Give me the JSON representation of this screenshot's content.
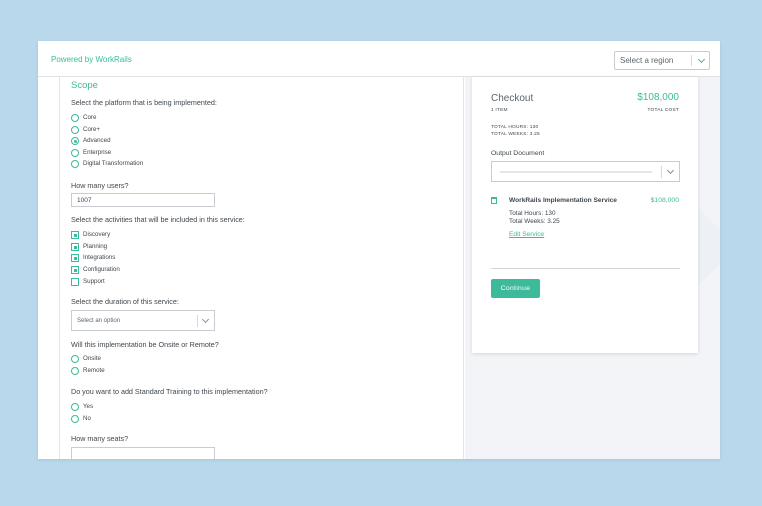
{
  "header": {
    "brand": "Powered by WorkRails",
    "region_select": {
      "value": "Select a region"
    }
  },
  "form": {
    "section_title": "Scope",
    "q_platform": "Select the platform that is being implemented:",
    "platforms": [
      {
        "label": "Core",
        "selected": false
      },
      {
        "label": "Core+",
        "selected": false
      },
      {
        "label": "Advanced",
        "selected": true
      },
      {
        "label": "Enterprise",
        "selected": false
      },
      {
        "label": "Digital Transformation",
        "selected": false
      }
    ],
    "q_users": "How many users?",
    "users_value": "1007",
    "q_activities": "Select the activities that will be included in this service:",
    "activities": [
      {
        "label": "Discovery",
        "checked": true
      },
      {
        "label": "Planning",
        "checked": true
      },
      {
        "label": "Integrations",
        "checked": true
      },
      {
        "label": "Configuration",
        "checked": true
      },
      {
        "label": "Support",
        "checked": false
      }
    ],
    "q_duration": "Select the duration of this service:",
    "duration_select": {
      "value": "Select an option"
    },
    "q_onsite": "Will this implementation be Onsite or Remote?",
    "onsite_options": [
      {
        "label": "Onsite",
        "selected": false
      },
      {
        "label": "Remote",
        "selected": false
      }
    ],
    "q_training": "Do you want to add Standard Training to this implementation?",
    "training_options": [
      {
        "label": "Yes",
        "selected": false
      },
      {
        "label": "No",
        "selected": false
      }
    ],
    "q_seats": "How many seats?",
    "seats_value": ""
  },
  "checkout": {
    "title": "Checkout",
    "total": "$108,000",
    "item_count": "1 ITEM",
    "total_cost_label": "TOTAL COST",
    "total_hours": "TOTAL HOURS: 130",
    "total_weeks": "TOTAL WEEKS: 3.25",
    "output_document_label": "Output Document",
    "service": {
      "name": "WorkRails Implementation Service",
      "price": "$108,000",
      "hours": "Total Hours: 130",
      "weeks": "Total Weeks: 3.25",
      "edit_label": "Edit Service"
    },
    "continue_label": "Continue"
  },
  "colors": {
    "accent": "#3dba9a",
    "background": "#b9d8ec",
    "text": "#3f474d"
  }
}
